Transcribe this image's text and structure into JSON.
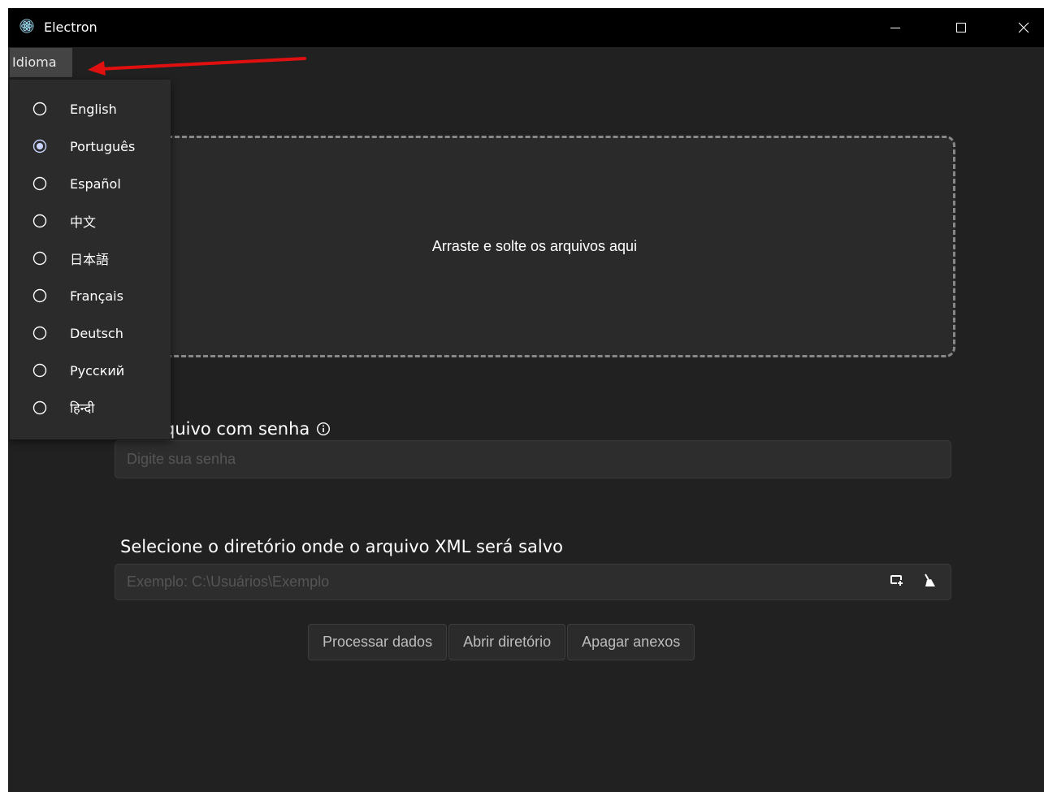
{
  "window": {
    "title": "Electron"
  },
  "menubar": {
    "items": [
      {
        "label": "Idioma"
      }
    ]
  },
  "language_menu": {
    "selected": "Português",
    "options": [
      {
        "label": "English",
        "selected": false
      },
      {
        "label": "Português",
        "selected": true
      },
      {
        "label": "Español",
        "selected": false
      },
      {
        "label": "中文",
        "selected": false
      },
      {
        "label": "日本語",
        "selected": false
      },
      {
        "label": "Français",
        "selected": false
      },
      {
        "label": "Deutsch",
        "selected": false
      },
      {
        "label": "Русский",
        "selected": false
      },
      {
        "label": "हिन्दी",
        "selected": false
      }
    ]
  },
  "drop_zone": {
    "text": "Arraste e solte os arquivos aqui"
  },
  "password": {
    "label_visible": "quivo com senha",
    "placeholder": "Digite sua senha",
    "value": ""
  },
  "directory": {
    "label": "Selecione o diretório onde o arquivo XML será salvo",
    "placeholder": "Exemplo: C:\\Usuários\\Exemplo",
    "value": ""
  },
  "actions": {
    "process": "Processar dados",
    "open_dir": "Abrir diretório",
    "clear": "Apagar anexos"
  },
  "colors": {
    "background": "#212121",
    "titlebar": "#000000",
    "menu": "#2b2b2b",
    "annotation_arrow": "#e01010"
  },
  "icons": {
    "app": "electron-logo-icon",
    "minimize": "minimize-icon",
    "maximize": "maximize-icon",
    "close": "close-icon",
    "info": "info-icon",
    "select_folder": "folder-select-icon",
    "clear_path": "broom-icon"
  }
}
